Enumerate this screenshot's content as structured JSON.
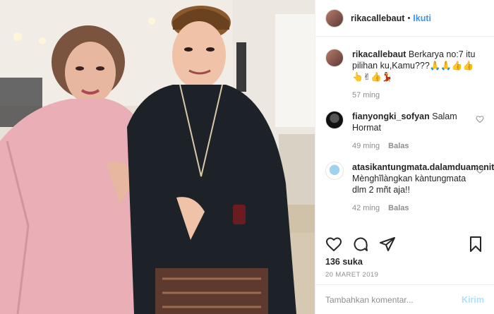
{
  "header": {
    "username": "rikacallebaut",
    "separator": "•",
    "follow_label": "Ikuti"
  },
  "caption": {
    "username": "rikacallebaut",
    "text": "Berkarya no:7 itu pilihan ku,Kamu???🙏🙏👍👍👆✌👍💃",
    "time": "57 ming"
  },
  "comments": [
    {
      "username": "fianyongki_sofyan",
      "text": "Salam Hormat",
      "time": "49 ming",
      "reply_label": "Balas"
    },
    {
      "username": "atasikantungmata.dalamduamenit",
      "text": "Mènghĩlàngkan kàntungmata dlm 2 mñt aja!!",
      "time": "42 ming",
      "reply_label": "Balas"
    }
  ],
  "likes": "136 suka",
  "date": "20 MARET 2019",
  "add_comment": {
    "placeholder": "Tambahkan komentar...",
    "post_label": "Kirim"
  },
  "icons": {
    "like": "heart-icon",
    "comment": "comment-icon",
    "share": "share-icon",
    "save": "bookmark-icon"
  },
  "colors": {
    "link_blue": "#3897f0",
    "post_disabled": "#b2dffc",
    "muted_text": "#8e8e8e"
  }
}
